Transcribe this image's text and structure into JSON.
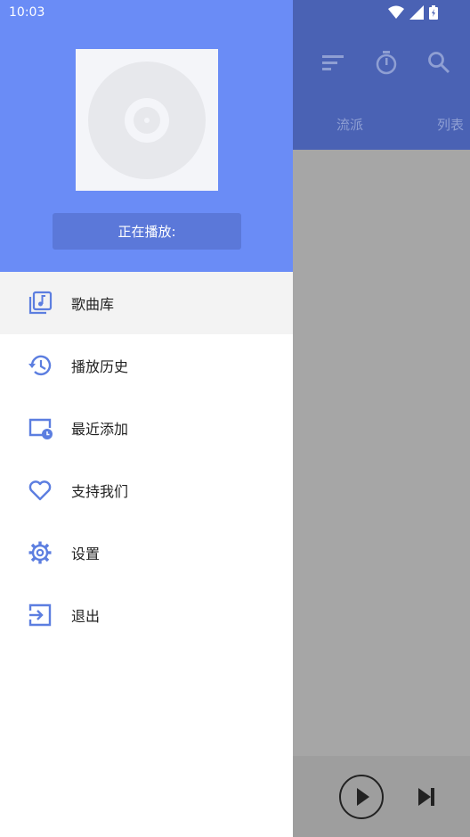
{
  "status": {
    "time": "10:03"
  },
  "toolbar": {
    "tabs": [
      "流派",
      "列表"
    ]
  },
  "drawer": {
    "now_playing_label": "正在播放:",
    "items": [
      {
        "label": "歌曲库",
        "icon": "library-music-icon",
        "active": true
      },
      {
        "label": "播放历史",
        "icon": "history-icon",
        "active": false
      },
      {
        "label": "最近添加",
        "icon": "recently-added-icon",
        "active": false
      },
      {
        "label": "支持我们",
        "icon": "heart-icon",
        "active": false
      },
      {
        "label": "设置",
        "icon": "gear-icon",
        "active": false
      },
      {
        "label": "退出",
        "icon": "exit-icon",
        "active": false
      }
    ]
  },
  "colors": {
    "accent": "#6a8cf6",
    "header_dimmed": "#4a62b4",
    "icon": "#5c7ee0"
  }
}
